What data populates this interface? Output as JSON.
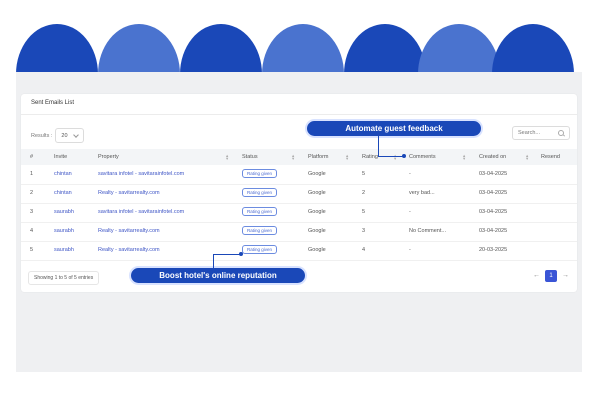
{
  "brand_colors": {
    "primary_blue": "#1a48b8",
    "light_blue": "#4a73cf",
    "accent": "#3a55d6"
  },
  "card": {
    "title": "Sent Emails List"
  },
  "controls": {
    "results_label": "Results :",
    "results_value": "20",
    "search_placeholder": "Search..."
  },
  "table": {
    "columns": [
      "#",
      "Invite",
      "Property",
      "Status",
      "Platform",
      "Rating",
      "Comments",
      "Created on",
      "Resend"
    ],
    "rows": [
      {
        "num": "1",
        "invite": "chintan",
        "property": "savitara infotel - savitarainfotel.com",
        "status": "Rating given",
        "platform": "Google",
        "rating": "5",
        "comments": "-",
        "created": "03-04-2025"
      },
      {
        "num": "2",
        "invite": "chintan",
        "property": "Realty - savitarrealty.com",
        "status": "Rating given",
        "platform": "Google",
        "rating": "2",
        "comments": "very bad...",
        "created": "03-04-2025"
      },
      {
        "num": "3",
        "invite": "saurabh",
        "property": "savitara infotel - savitarainfotel.com",
        "status": "Rating given",
        "platform": "Google",
        "rating": "5",
        "comments": "-",
        "created": "03-04-2025"
      },
      {
        "num": "4",
        "invite": "saurabh",
        "property": "Realty - savitarrealty.com",
        "status": "Rating given",
        "platform": "Google",
        "rating": "3",
        "comments": "No Comment...",
        "created": "03-04-2025"
      },
      {
        "num": "5",
        "invite": "saurabh",
        "property": "Realty - savitarrealty.com",
        "status": "Rating given",
        "platform": "Google",
        "rating": "4",
        "comments": "-",
        "created": "20-03-2025"
      }
    ]
  },
  "footer": {
    "showing": "Showing 1 to 5 of 5 entries",
    "current_page": "1",
    "prev_icon": "arrow-left-icon",
    "next_icon": "arrow-right-icon"
  },
  "callouts": {
    "top": "Automate guest feedback",
    "bottom": "Boost hotel's online reputation"
  }
}
